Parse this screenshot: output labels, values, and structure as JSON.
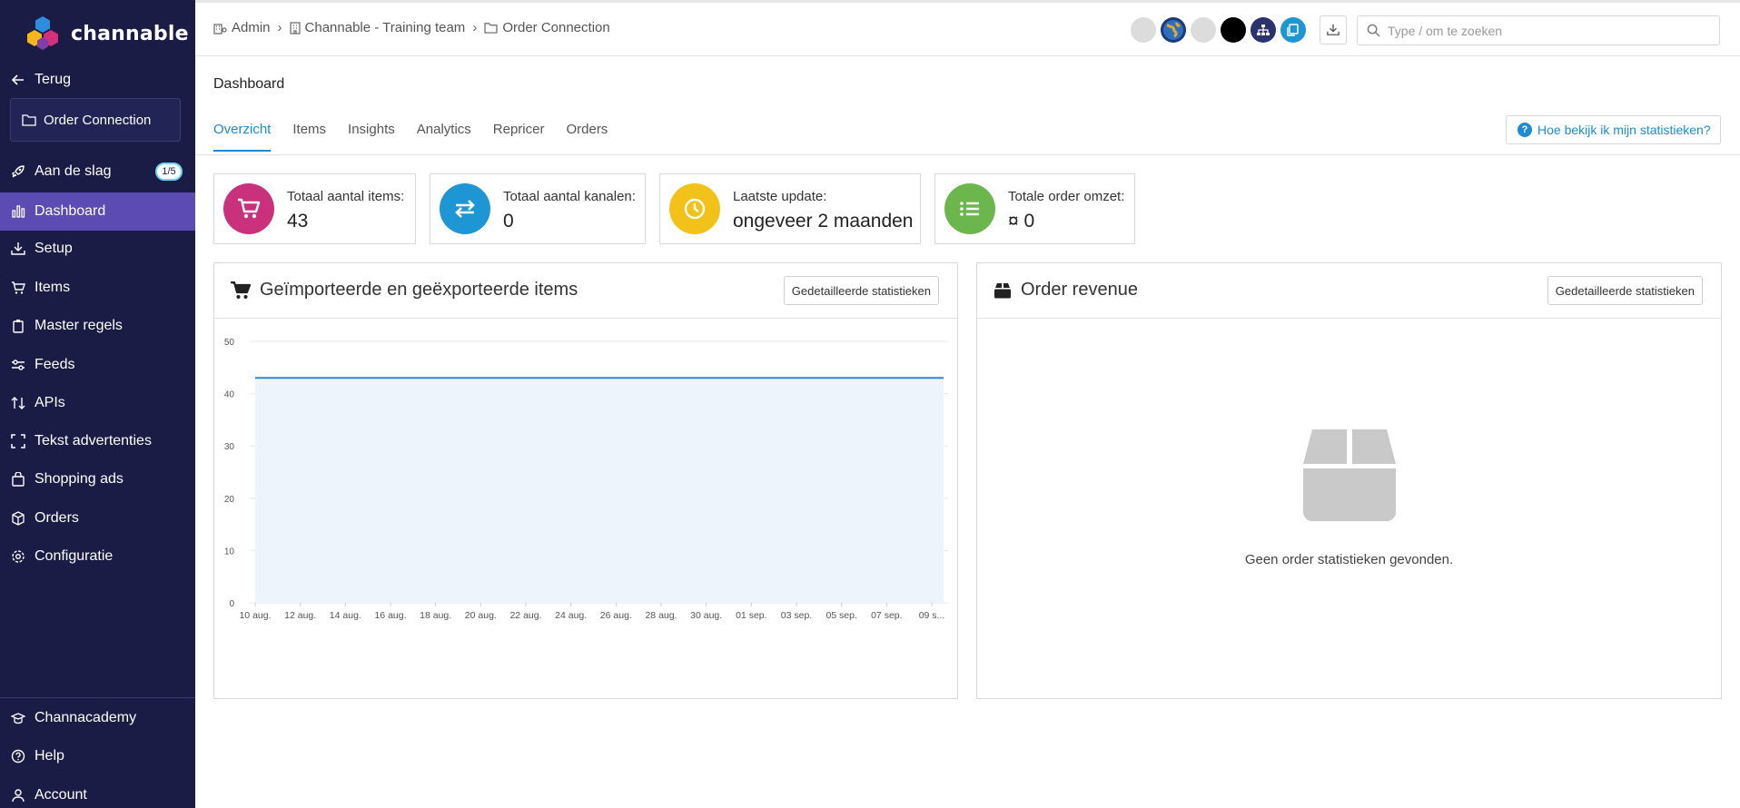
{
  "brand": {
    "name": "channable"
  },
  "sidebar": {
    "back_label": "Terug",
    "project": "Order Connection",
    "items": [
      {
        "label": "Aan de slag",
        "badge": "1/5",
        "icon": "rocket-icon"
      },
      {
        "label": "Dashboard",
        "icon": "bar-chart-icon",
        "active": true
      },
      {
        "label": "Setup",
        "icon": "download-tray-icon"
      },
      {
        "label": "Items",
        "icon": "cart-icon"
      },
      {
        "label": "Master regels",
        "icon": "clipboard-icon"
      },
      {
        "label": "Feeds",
        "icon": "sliders-icon"
      },
      {
        "label": "APIs",
        "icon": "sort-arrows-icon"
      },
      {
        "label": "Tekst advertenties",
        "icon": "frame-icon"
      },
      {
        "label": "Shopping ads",
        "icon": "shopping-bag-icon"
      },
      {
        "label": "Orders",
        "icon": "box-icon"
      },
      {
        "label": "Configuratie",
        "icon": "gear-icon"
      }
    ],
    "bottom": [
      {
        "label": "Channacademy",
        "icon": "graduation-cap-icon"
      },
      {
        "label": "Help",
        "icon": "question-circle-icon"
      },
      {
        "label": "Account",
        "icon": "user-icon"
      }
    ]
  },
  "breadcrumb": [
    "Admin",
    "Channable - Training team",
    "Order Connection"
  ],
  "search": {
    "placeholder": "Type / om te zoeken"
  },
  "page": {
    "title": "Dashboard",
    "tabs": [
      "Overzicht",
      "Items",
      "Insights",
      "Analytics",
      "Repricer",
      "Orders"
    ],
    "active_tab": "Overzicht",
    "help_label": "Hoe bekijk ik mijn statistieken?"
  },
  "stats": [
    {
      "label": "Totaal aantal items:",
      "value": "43",
      "color": "#c9317d",
      "icon": "cart-icon"
    },
    {
      "label": "Totaal aantal kanalen:",
      "value": "0",
      "color": "#1f96d4",
      "icon": "exchange-arrows-icon"
    },
    {
      "label": "Laatste update:",
      "value": "ongeveer 2 maanden",
      "color": "#f2c21b",
      "icon": "clock-icon"
    },
    {
      "label": "Totale order omzet:",
      "value": "¤ 0",
      "color": "#6cb64e",
      "icon": "list-icon"
    }
  ],
  "panels": {
    "items_chart": {
      "title": "Geïmporteerde en geëxporteerde items",
      "button": "Gedetailleerde statistieken"
    },
    "order_revenue": {
      "title": "Order revenue",
      "button": "Gedetailleerde statistieken",
      "empty_message": "Geen order statistieken gevonden."
    }
  },
  "chart_data": {
    "type": "area",
    "title": "Geïmporteerde en geëxporteerde items",
    "xlabel": "",
    "ylabel": "",
    "ylim": [
      0,
      50
    ],
    "yticks": [
      0,
      10,
      20,
      30,
      40,
      50
    ],
    "x_tick_labels": [
      "10 aug.",
      "12 aug.",
      "14 aug.",
      "16 aug.",
      "18 aug.",
      "20 aug.",
      "22 aug.",
      "24 aug.",
      "26 aug.",
      "28 aug.",
      "30 aug.",
      "01 sep.",
      "03 sep.",
      "05 sep.",
      "07 sep.",
      "09 s..."
    ],
    "series": [
      {
        "values": [
          43,
          43,
          43,
          43,
          43,
          43,
          43,
          43,
          43,
          43,
          43,
          43,
          43,
          43,
          43,
          43,
          43,
          43,
          43,
          43,
          43,
          43,
          43,
          43,
          43,
          43,
          43,
          43,
          43,
          43,
          43,
          43
        ]
      }
    ],
    "line_color": "#2d87d3",
    "fill_color": "#edf4fc",
    "grid": true
  }
}
